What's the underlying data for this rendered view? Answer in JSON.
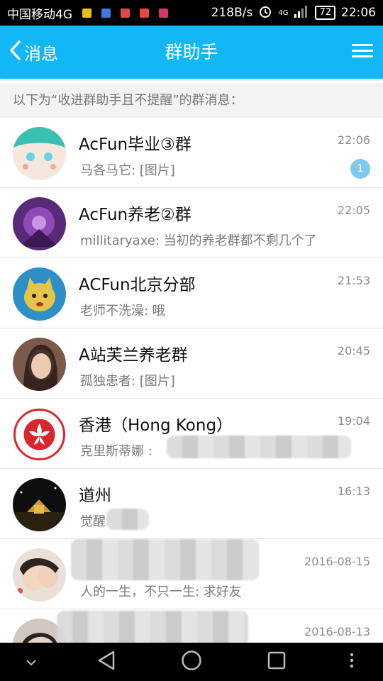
{
  "status_bar": {
    "carrier": "中国移动4G",
    "speed": "218B/s",
    "net_type": "4G",
    "battery": "72",
    "clock": "22:06"
  },
  "header": {
    "back_label": "消息",
    "title": "群助手"
  },
  "subheader": "以下为“收进群助手且不提醒”的群消息：",
  "groups": [
    {
      "name": "AcFun毕业③群",
      "time": "22:06",
      "preview": "马各马它: [图片]",
      "unread": "1"
    },
    {
      "name": "AcFun养老②群",
      "time": "22:05",
      "preview": "millitaryaxe: 当初的养老群都不剩几个了"
    },
    {
      "name": "ACFun北京分部",
      "time": "21:53",
      "preview": "老师不洗澡: 哦"
    },
    {
      "name": "A站芙兰养老群",
      "time": "20:45",
      "preview": "孤独患者: [图片]"
    },
    {
      "name": "香港（Hong Kong）",
      "time": "19:04",
      "preview": "克里斯蒂娜 :"
    },
    {
      "name": "道州",
      "time": "16:13",
      "preview": "觉醒"
    },
    {
      "name": "",
      "time": "2016-08-15",
      "preview": "人的一生，不只一生: 求好友"
    },
    {
      "name": "",
      "time": "2016-08-13",
      "preview": ""
    }
  ],
  "colors": {
    "accent": "#12b7f5",
    "badge": "#7fc8ee"
  }
}
